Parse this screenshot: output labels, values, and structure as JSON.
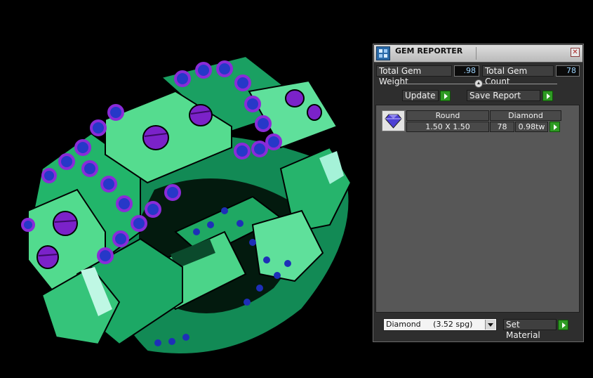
{
  "window": {
    "title": "GEM REPORTER",
    "close_label": "✕"
  },
  "totals": {
    "weight_label": "Total Gem Weight",
    "weight_value": ".98",
    "count_label": "Total Gem Count",
    "count_value": "78"
  },
  "actions": {
    "update_label": "Update",
    "save_report_label": "Save Report"
  },
  "report": {
    "rows": [
      {
        "shape": "Round",
        "material": "Diamond",
        "size": "1.50 X 1.50",
        "count": "78",
        "weight": "0.98tw"
      }
    ]
  },
  "material": {
    "selected": "Diamond     (3.52 spg)",
    "set_label": "Set Material"
  },
  "colors": {
    "ring_green": "#3fcf7e",
    "gem_blue": "#2638c8",
    "prong_purple": "#8a2bd8",
    "go_button_green": "#2e9a23"
  },
  "icons": {
    "panel": "gem-reporter-icon",
    "gem": "round-gem-icon",
    "go": "play-arrow-icon",
    "close": "close-icon"
  }
}
